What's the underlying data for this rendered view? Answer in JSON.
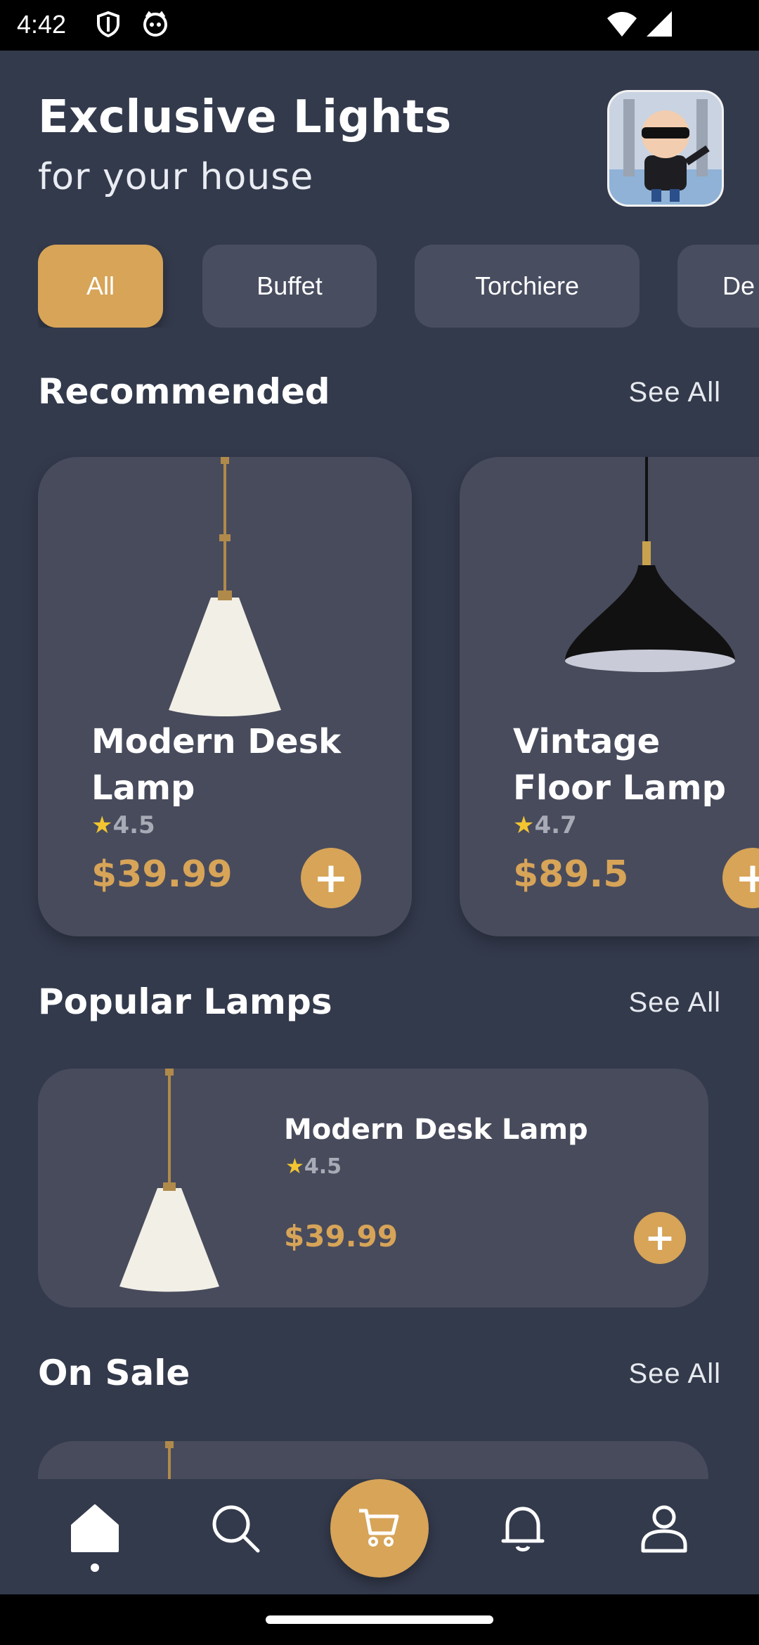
{
  "status_bar": {
    "time": "4:42"
  },
  "header": {
    "title": "Exclusive Lights",
    "subtitle": "for your house"
  },
  "categories": [
    {
      "label": "All",
      "active": true
    },
    {
      "label": "Buffet",
      "active": false
    },
    {
      "label": "Torchiere",
      "active": false
    },
    {
      "label": "De",
      "active": false
    }
  ],
  "recommended": {
    "title": "Recommended",
    "see_all": "See All",
    "items": [
      {
        "name": "Modern Desk Lamp",
        "rating": "4.5",
        "price": "$39.99"
      },
      {
        "name": "Vintage Floor Lamp",
        "rating": "4.7",
        "price": "$89.5"
      }
    ]
  },
  "popular": {
    "title": "Popular Lamps",
    "see_all": "See All",
    "items": [
      {
        "name": "Modern Desk Lamp",
        "rating": "4.5",
        "price": "$39.99"
      }
    ]
  },
  "on_sale": {
    "title": "On Sale",
    "see_all": "See All"
  },
  "nav": {
    "items": [
      "home-icon",
      "search-icon",
      "cart-icon",
      "bell-icon",
      "profile-icon"
    ],
    "active": "home-icon"
  },
  "colors": {
    "background": "#333a4c",
    "card": "#484b5c",
    "accent": "#d7a458",
    "star": "#f2c531"
  }
}
